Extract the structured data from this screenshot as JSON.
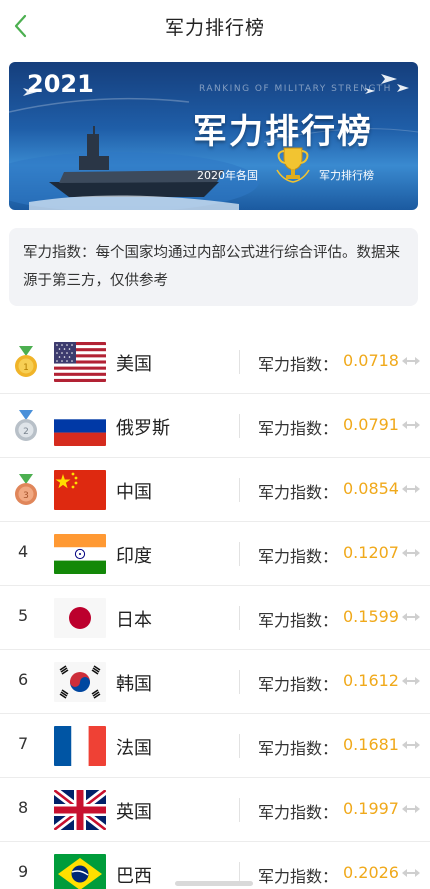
{
  "header": {
    "title": "军力排行榜"
  },
  "banner": {
    "year": "2021",
    "subtitle_en": "RANKING OF MILITARY STRENGTH",
    "title": "军力排行榜",
    "caption_left": "2020年各国",
    "caption_right": "军力排行榜"
  },
  "note": {
    "text": "军力指数：每个国家均通过内部公式进行综合评估。数据来源于第三方，仅供参考"
  },
  "score_label": "军力指数：",
  "colors": {
    "accent": "#f0a91b",
    "back": "#4caf50"
  },
  "rows": [
    {
      "rank": "",
      "medal": "gold-medal-icon",
      "flag": "usa-flag-icon",
      "country": "美国",
      "score_label": "军力指数：",
      "score": "0.0718"
    },
    {
      "rank": "",
      "medal": "silver-medal-icon",
      "flag": "russia-flag-icon",
      "country": "俄罗斯",
      "score_label": "军力指数：",
      "score": "0.0791"
    },
    {
      "rank": "",
      "medal": "bronze-medal-icon",
      "flag": "china-flag-icon",
      "country": "中国",
      "score_label": "军力指数：",
      "score": "0.0854"
    },
    {
      "rank": "4",
      "flag": "india-flag-icon",
      "country": "印度",
      "score_label": "军力指数：",
      "score": "0.1207"
    },
    {
      "rank": "5",
      "flag": "japan-flag-icon",
      "country": "日本",
      "score_label": "军力指数：",
      "score": "0.1599"
    },
    {
      "rank": "6",
      "flag": "korea-flag-icon",
      "country": "韩国",
      "score_label": "军力指数：",
      "score": "0.1612"
    },
    {
      "rank": "7",
      "flag": "france-flag-icon",
      "country": "法国",
      "score_label": "军力指数：",
      "score": "0.1681"
    },
    {
      "rank": "8",
      "flag": "uk-flag-icon",
      "country": "英国",
      "score_label": "军力指数：",
      "score": "0.1997"
    },
    {
      "rank": "9",
      "flag": "brazil-flag-icon",
      "country": "巴西",
      "score_label": "军力指数：",
      "score": "0.2026"
    }
  ]
}
